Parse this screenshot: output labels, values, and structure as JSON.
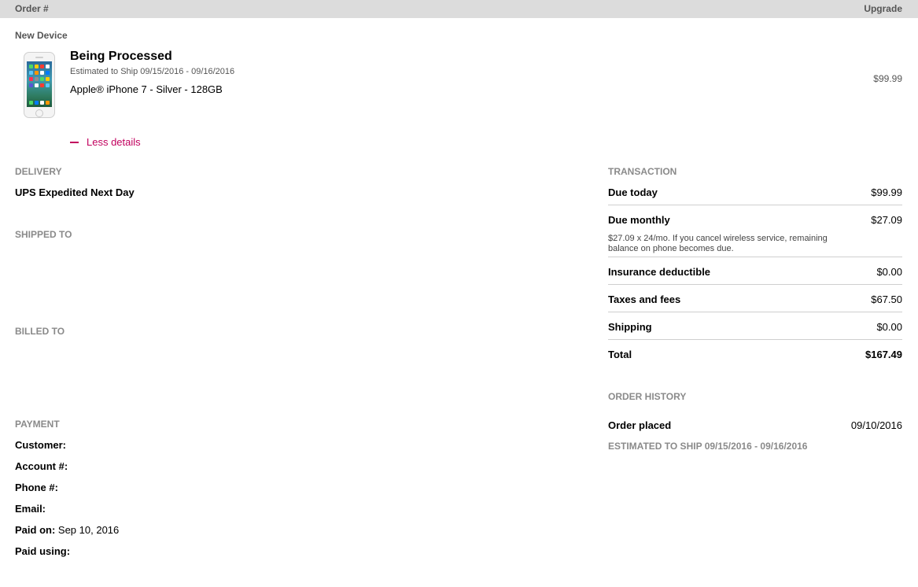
{
  "header": {
    "order_label": "Order #",
    "upgrade_label": "Upgrade"
  },
  "device": {
    "section_label": "New Device",
    "status": "Being Processed",
    "estimated_ship": "Estimated to Ship 09/15/2016 - 09/16/2016",
    "name": "Apple® iPhone 7 - Silver - 128GB",
    "price": "$99.99",
    "less_details": "Less details"
  },
  "delivery": {
    "label": "DELIVERY",
    "method": "UPS Expedited Next Day"
  },
  "shipped_to": {
    "label": "SHIPPED TO"
  },
  "billed_to": {
    "label": "BILLED TO"
  },
  "payment": {
    "label": "PAYMENT",
    "customer_label": "Customer:",
    "account_label": "Account #:",
    "phone_label": "Phone #:",
    "email_label": "Email:",
    "paid_on_label": "Paid on:",
    "paid_on_value": "Sep 10, 2016",
    "paid_using_label": "Paid using:"
  },
  "transaction": {
    "label": "TRANSACTION",
    "rows": [
      {
        "label": "Due today",
        "value": "$99.99"
      },
      {
        "label": "Due monthly",
        "value": "$27.09",
        "note": "$27.09 x 24/mo. If you cancel wireless service, remaining balance on phone becomes due."
      },
      {
        "label": "Insurance deductible",
        "value": "$0.00"
      },
      {
        "label": "Taxes and fees",
        "value": "$67.50"
      },
      {
        "label": "Shipping",
        "value": "$0.00"
      },
      {
        "label": "Total",
        "value": "$167.49"
      }
    ]
  },
  "order_history": {
    "label": "ORDER HISTORY",
    "placed_label": "Order placed",
    "placed_value": "09/10/2016",
    "estimated_label": "ESTIMATED TO SHIP",
    "estimated_value": "09/15/2016 - 09/16/2016"
  }
}
